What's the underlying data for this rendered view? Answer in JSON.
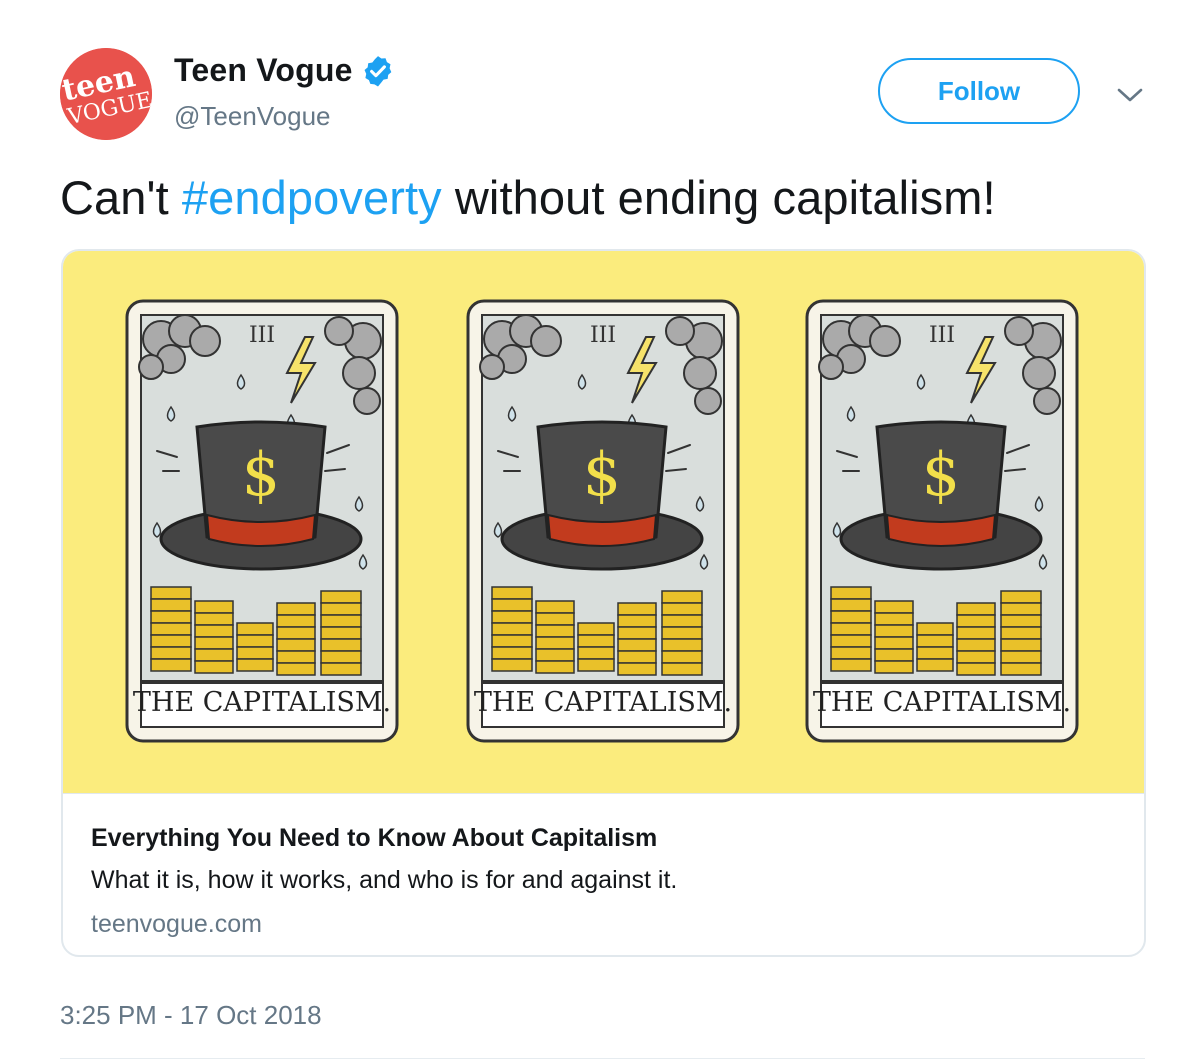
{
  "account": {
    "display_name": "Teen Vogue",
    "handle": "@TeenVogue",
    "avatar_text_top": "teen",
    "avatar_text_bottom": "VOGUE",
    "verified": true
  },
  "actions": {
    "follow_label": "Follow",
    "more_icon": "chevron-down-icon"
  },
  "tweet": {
    "text_before": "Can't ",
    "hashtag": "#endpoverty",
    "text_after": " without ending capitalism!",
    "timestamp": "3:25 PM - 17 Oct 2018"
  },
  "link_card": {
    "title": "Everything You Need to Know About Capitalism",
    "description": "What it is, how it works, and who is for and against it.",
    "domain": "teenvogue.com",
    "image": {
      "background_color": "#fbec7d",
      "cards": [
        {
          "numeral": "III",
          "label": "THE CAPITALISM."
        },
        {
          "numeral": "III",
          "label": "THE CAPITALISM."
        },
        {
          "numeral": "III",
          "label": "THE CAPITALISM."
        }
      ]
    }
  },
  "colors": {
    "accent": "#1da1f2",
    "secondary_text": "#657786",
    "avatar_bg": "#e8524c"
  }
}
